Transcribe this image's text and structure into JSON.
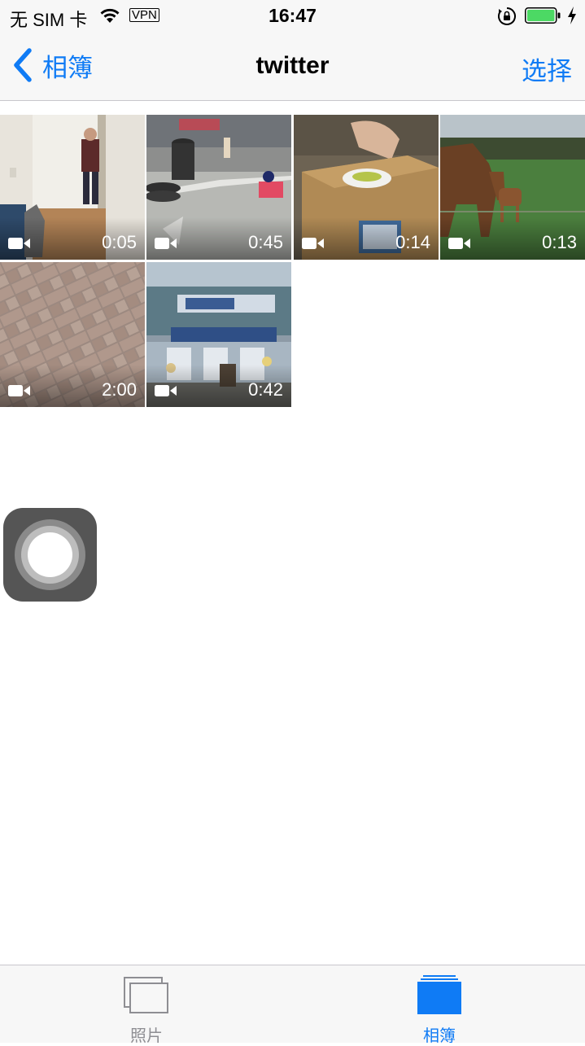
{
  "status_bar": {
    "carrier": "无 SIM 卡",
    "vpn": "VPN",
    "time": "16:47"
  },
  "nav": {
    "back_label": "相簿",
    "title": "twitter",
    "select_label": "选择"
  },
  "videos": [
    {
      "duration": "0:05",
      "icon": "video-camera-icon"
    },
    {
      "duration": "0:45",
      "icon": "video-camera-icon"
    },
    {
      "duration": "0:14",
      "icon": "video-camera-icon"
    },
    {
      "duration": "0:13",
      "icon": "video-camera-icon"
    },
    {
      "duration": "2:00",
      "icon": "video-camera-icon"
    },
    {
      "duration": "0:42",
      "icon": "video-camera-icon"
    }
  ],
  "tabs": [
    {
      "label": "照片",
      "icon": "photos-stack-icon",
      "active": false
    },
    {
      "label": "相簿",
      "icon": "albums-stack-icon",
      "active": true
    }
  ],
  "colors": {
    "accent": "#0f7bf5",
    "battery": "#4cd964",
    "inactive": "#8e8e93"
  }
}
